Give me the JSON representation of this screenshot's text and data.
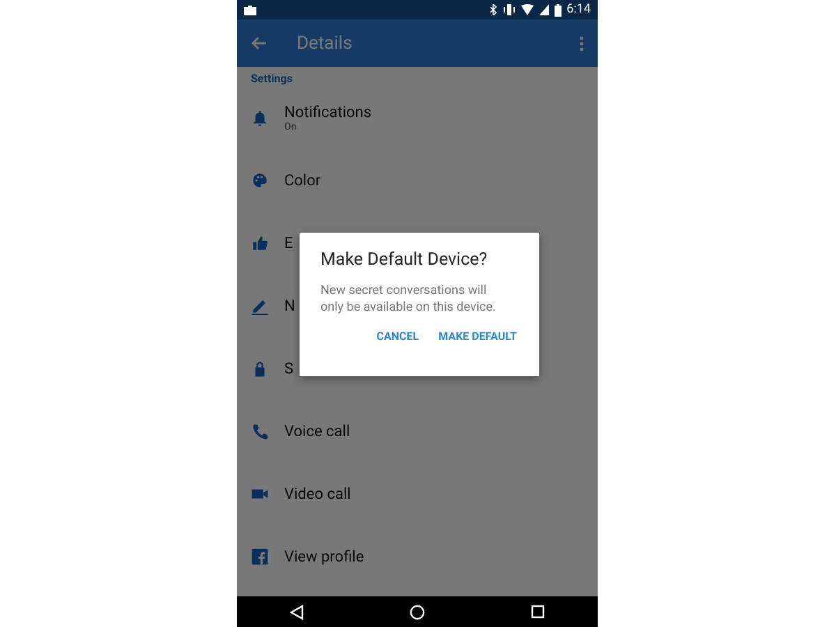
{
  "status_bar": {
    "time": "6:14"
  },
  "app_bar": {
    "title": "Details"
  },
  "section_header": "Settings",
  "items": [
    {
      "label": "Notifications",
      "subtitle": "On"
    },
    {
      "label": "Color"
    },
    {
      "label": "E"
    },
    {
      "label": "N"
    },
    {
      "label": "S"
    },
    {
      "label": "Voice call"
    },
    {
      "label": "Video call"
    },
    {
      "label": "View profile"
    }
  ],
  "dialog": {
    "title": "Make Default Device?",
    "message": "New secret conversations will only be available on this device.",
    "buttons": [
      "CANCEL",
      "MAKE DEFAULT"
    ]
  }
}
